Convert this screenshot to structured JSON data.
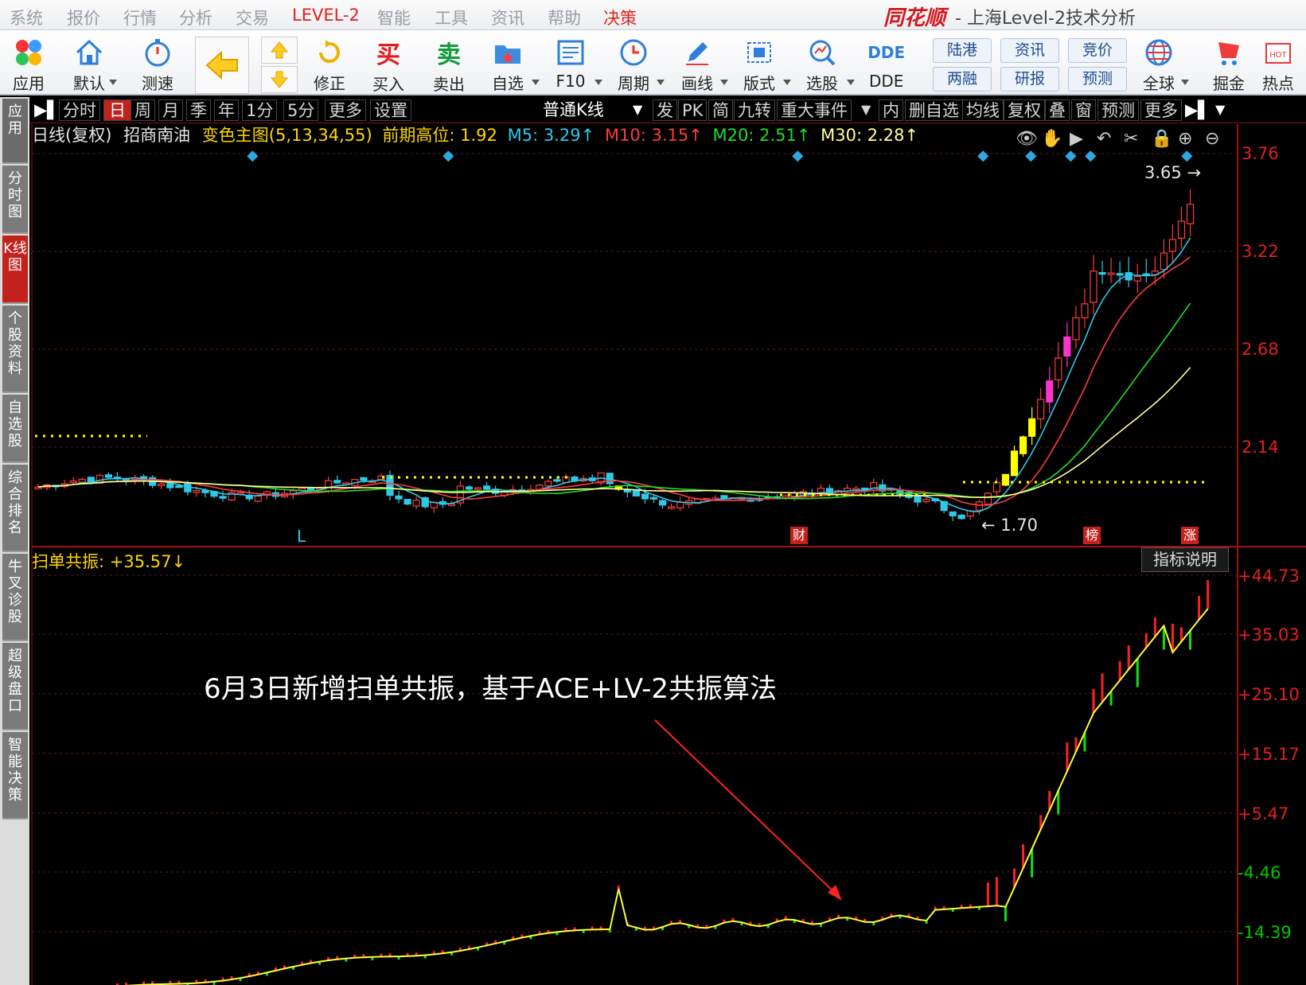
{
  "menu": {
    "items": [
      "系统",
      "报价",
      "行情",
      "分析",
      "交易",
      "LEVEL-2",
      "智能",
      "工具",
      "资讯",
      "帮助",
      "决策"
    ],
    "brand": "同花顺",
    "title": "- 上海Level-2技术分析"
  },
  "toolbar": {
    "buttons": [
      "应用",
      "默认",
      "测速",
      "修正",
      "买入",
      "卖出",
      "自选",
      "F10",
      "周期",
      "画线",
      "版式",
      "选股",
      "DDE",
      "全球",
      "掘金",
      "热点"
    ],
    "small_buttons": [
      "陆港",
      "两融",
      "资讯",
      "研报",
      "竞价",
      "预测"
    ],
    "buy_glyph": "买",
    "sell_glyph": "卖",
    "dde_glyph": "DDE"
  },
  "sidebar": {
    "tabs": [
      "应用",
      "分时图",
      "K线图",
      "个股资料",
      "自选股",
      "综合排名",
      "牛叉诊股",
      "超级盘口",
      "智能决策"
    ],
    "active": "K线图"
  },
  "chartbar": {
    "periods": [
      "分时",
      "日",
      "周",
      "月",
      "季",
      "年",
      "1分",
      "5分",
      "更多",
      "设置"
    ],
    "active_period": "日",
    "kline_type": "普通K线",
    "tools": [
      "发",
      "PK",
      "简",
      "九转",
      "重大事件",
      "内",
      "删自选",
      "均线",
      "复权",
      "叠",
      "窗",
      "预测",
      "更多"
    ]
  },
  "legend": {
    "period": "日线(复权)",
    "stock": "招商南油",
    "main_indicator": "变色主图(5,13,34,55)",
    "prev_high": "前期高位: 1.92",
    "m5": "M5: 3.29↑",
    "m10": "M10: 3.15↑",
    "m20": "M20: 2.51↑",
    "m30": "M30: 2.28↑",
    "colors": {
      "m5": "#2ec8ea",
      "m10": "#ff3b3b",
      "m20": "#22dd22",
      "m30": "#ffff99"
    }
  },
  "price_axis": [
    "3.76",
    "3.22",
    "2.68",
    "2.14"
  ],
  "markers": {
    "high": "3.65",
    "low": "1.70",
    "L": "L",
    "cai": "财",
    "bang": "榜",
    "zhang": "涨"
  },
  "indicator": {
    "name": "扫单共振: +35.57↓",
    "button": "指标说明",
    "axis": [
      "+44.73",
      "+35.03",
      "+25.10",
      "+15.17",
      "+5.47",
      "-4.46",
      "-14.39"
    ]
  },
  "annotation": "6月3日新增扫单共振，基于ACE+LV-2共振算法",
  "chart_data": {
    "type": "candlestick",
    "title": "招商南油 日线(复权)",
    "ylim": [
      1.55,
      3.9
    ],
    "series_approx": {
      "low": 1.7,
      "high": 3.65,
      "last_ma": {
        "M5": 3.29,
        "M10": 3.15,
        "M20": 2.51,
        "M30": 2.28
      }
    },
    "indicator_ylim": [
      -20,
      50
    ]
  }
}
